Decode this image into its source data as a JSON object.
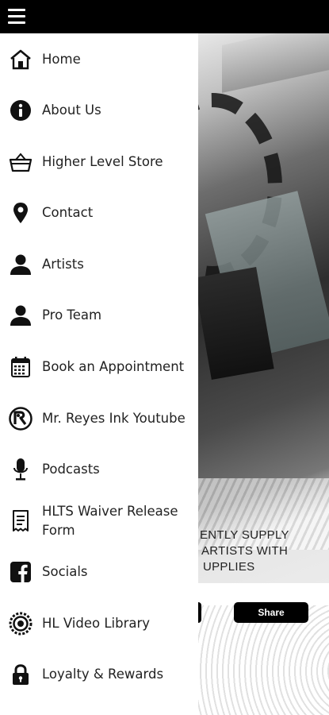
{
  "topbar": {
    "menu_icon": "hamburger-menu-icon"
  },
  "drawer": {
    "items": [
      {
        "label": "Home",
        "icon": "home-icon"
      },
      {
        "label": "About Us",
        "icon": "info-icon"
      },
      {
        "label": "Higher Level Store",
        "icon": "basket-icon"
      },
      {
        "label": "Contact",
        "icon": "map-pin-icon"
      },
      {
        "label": "Artists",
        "icon": "person-icon"
      },
      {
        "label": "Pro Team",
        "icon": "person-icon"
      },
      {
        "label": "Book an Appointment",
        "icon": "calendar-icon"
      },
      {
        "label": "Mr. Reyes Ink Youtube",
        "icon": "reyes-logo-icon"
      },
      {
        "label": "Podcasts",
        "icon": "microphone-icon"
      },
      {
        "label": "HLTS Waiver Release Form",
        "icon": "form-icon"
      },
      {
        "label": "Socials",
        "icon": "facebook-icon"
      },
      {
        "label": "HL Video Library",
        "icon": "emblem-icon"
      },
      {
        "label": "Loyalty & Rewards",
        "icon": "lock-icon"
      }
    ]
  },
  "background": {
    "promo_lines": [
      "ENTLY SUPPLY",
      "ARTISTS WITH",
      "UPPLIES"
    ],
    "share_label": "Share"
  }
}
